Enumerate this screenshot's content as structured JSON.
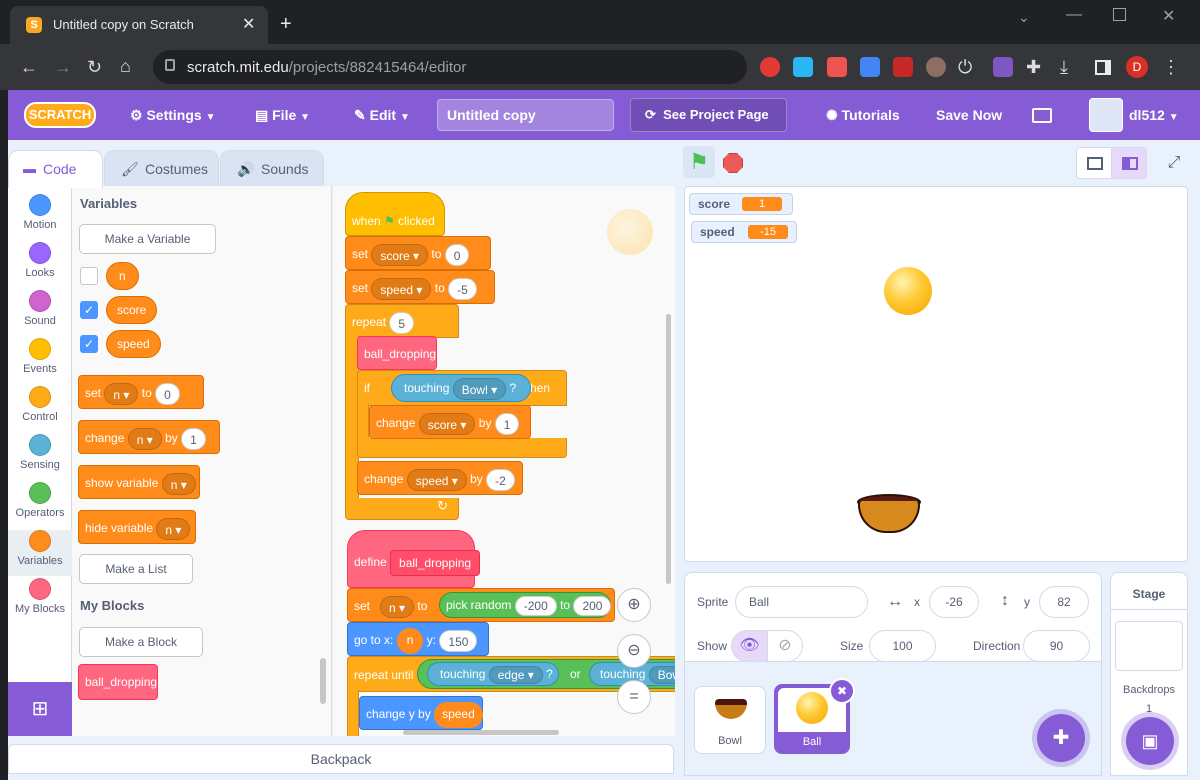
{
  "browser": {
    "tab_title": "Untitled copy on Scratch",
    "url_domain": "scratch.mit.edu",
    "url_path": "/projects/882415464/editor",
    "profile_initial": "D"
  },
  "menubar": {
    "logo": "SCRATCH",
    "settings": "Settings",
    "file": "File",
    "edit": "Edit",
    "project_title": "Untitled copy",
    "see_project_page": "See Project Page",
    "tutorials": "Tutorials",
    "save_now": "Save Now",
    "username": "dl512",
    "accent": "#855cd6"
  },
  "tabs": {
    "code": "Code",
    "costumes": "Costumes",
    "sounds": "Sounds"
  },
  "categories": [
    {
      "label": "Motion",
      "color": "#4c97ff"
    },
    {
      "label": "Looks",
      "color": "#9966ff"
    },
    {
      "label": "Sound",
      "color": "#cf63cf"
    },
    {
      "label": "Events",
      "color": "#ffbf00"
    },
    {
      "label": "Control",
      "color": "#ffab19"
    },
    {
      "label": "Sensing",
      "color": "#5cb1d6"
    },
    {
      "label": "Operators",
      "color": "#59c059"
    },
    {
      "label": "Variables",
      "color": "#ff8c1a"
    },
    {
      "label": "My Blocks",
      "color": "#ff6680"
    }
  ],
  "palette": {
    "variables_heading": "Variables",
    "make_variable": "Make a Variable",
    "vars": [
      "n",
      "score",
      "speed"
    ],
    "set_block": {
      "kw": "set",
      "var": "n",
      "to": "to",
      "val": "0"
    },
    "change_block": {
      "kw": "change",
      "var": "n",
      "by": "by",
      "val": "1"
    },
    "show_block": {
      "kw": "show variable",
      "var": "n"
    },
    "hide_block": {
      "kw": "hide variable",
      "var": "n"
    },
    "make_list": "Make a List",
    "myblocks_heading": "My Blocks",
    "make_block": "Make a Block",
    "custom_block": "ball_dropping"
  },
  "script": {
    "when": "when",
    "clicked": "clicked",
    "set1": {
      "kw": "set",
      "var": "score",
      "to": "to",
      "val": "0"
    },
    "set2": {
      "kw": "set",
      "var": "speed",
      "to": "to",
      "val": "-5"
    },
    "repeat": {
      "kw": "repeat",
      "val": "5"
    },
    "call": "ball_dropping",
    "if": {
      "kw": "if",
      "touching": "touching",
      "obj": "Bowl",
      "q": "?",
      "then": "then"
    },
    "change1": {
      "kw": "change",
      "var": "score",
      "by": "by",
      "val": "1"
    },
    "change2": {
      "kw": "change",
      "var": "speed",
      "by": "by",
      "val": "-2"
    },
    "define": {
      "kw": "define",
      "name": "ball_dropping"
    },
    "set3": {
      "kw": "set",
      "var": "n",
      "to": "to",
      "op": "pick random",
      "a": "-200",
      "to2": "to",
      "b": "200"
    },
    "goto": {
      "kw": "go to x:",
      "x": "n",
      "ylbl": "y:",
      "y": "150"
    },
    "repeat_until": {
      "kw": "repeat until",
      "t1": "touching",
      "o1": "edge",
      "q": "?",
      "or": "or",
      "t2": "touching",
      "o2": "Bow"
    },
    "changey": {
      "kw": "change y by",
      "val": "speed"
    },
    "zoom_reset": "="
  },
  "backpack": "Backpack",
  "monitors": [
    {
      "label": "score",
      "value": "1"
    },
    {
      "label": "speed",
      "value": "-15"
    }
  ],
  "sprite_info": {
    "sprite_label": "Sprite",
    "sprite_name": "Ball",
    "x_label": "x",
    "x": "-26",
    "y_label": "y",
    "y": "82",
    "show_label": "Show",
    "size_label": "Size",
    "size": "100",
    "direction_label": "Direction",
    "direction": "90"
  },
  "sprites": [
    {
      "name": "Bowl"
    },
    {
      "name": "Ball"
    }
  ],
  "stage_pane": {
    "title": "Stage",
    "backdrops_label": "Backdrops",
    "backdrops_count": "1"
  }
}
